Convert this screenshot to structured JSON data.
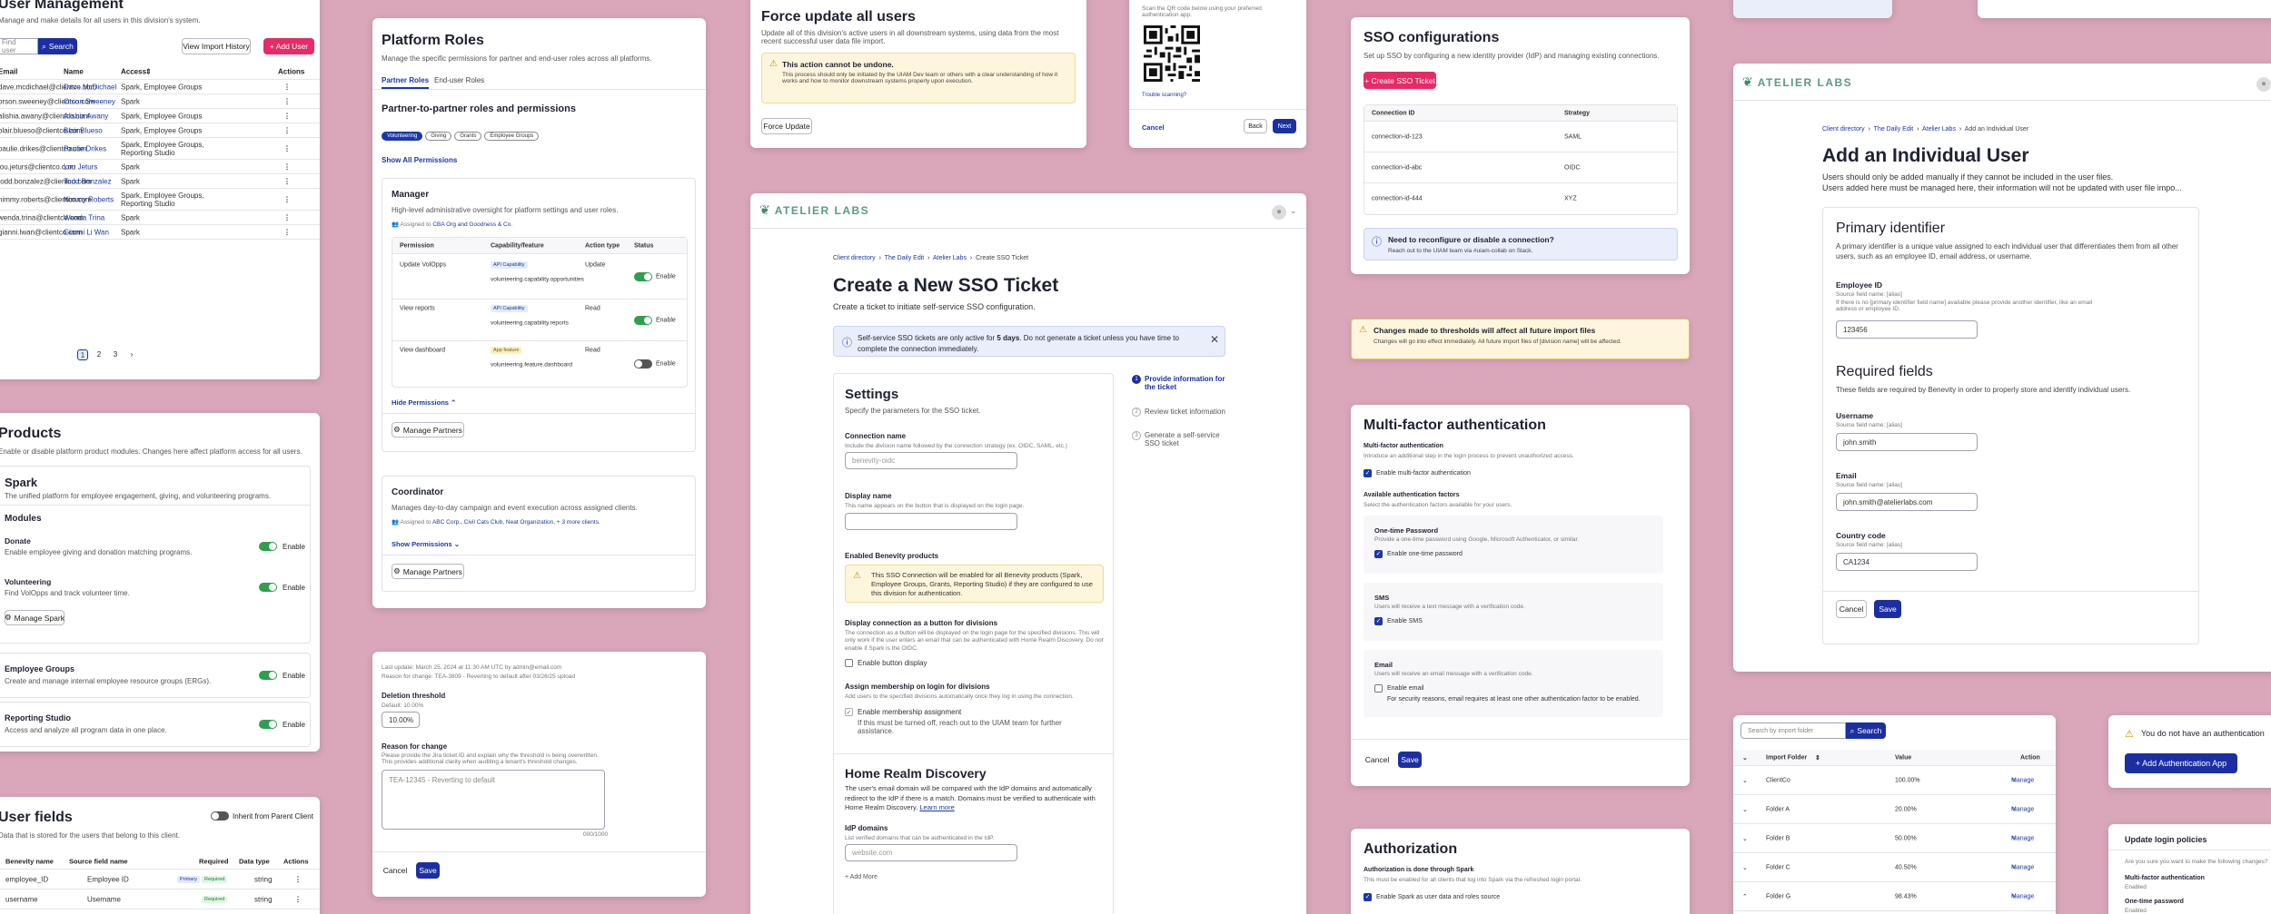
{
  "um": {
    "title": "User Management",
    "desc": "Manage and make details for all users in this division's system.",
    "search_ph": "Find user",
    "search_btn": "Search",
    "history_btn": "View Import History",
    "add_btn": "+ Add User",
    "cols": [
      "Email",
      "Name",
      "Access",
      "Actions"
    ],
    "rows": [
      [
        "dave.mcdichael@clientco.com",
        "Dave McDichael",
        "Spark, Employee Groups"
      ],
      [
        "orson.sweeney@clientco.com",
        "Orson Sweeney",
        "Spark"
      ],
      [
        "alishia.awany@clientco.com",
        "Alishia Awany",
        "Spark, Employee Groups"
      ],
      [
        "blair.blueso@clientco.com",
        "Blair Blueso",
        "Spark, Employee Groups"
      ],
      [
        "paulie.drikes@clientco.com",
        "Paulie Drikes",
        "Spark, Employee Groups, Reporting Studio"
      ],
      [
        "lou.jeturs@clientco.com",
        "Lou Jeturs",
        "Spark"
      ],
      [
        "todd.bonzalez@clientco.com",
        "Todd Bonzalez",
        "Spark"
      ],
      [
        "nimmy.roberts@clientco.com",
        "Nimmy Roberts",
        "Spark, Employee Groups, Reporting Studio"
      ],
      [
        "wenda.trina@clientco.com",
        "Wenda Trina",
        "Spark"
      ],
      [
        "gianni.lwan@clientco.com",
        "Gianni Li Wan",
        "Spark"
      ]
    ],
    "pages": [
      "1",
      "2",
      "3",
      "›"
    ]
  },
  "products": {
    "title": "Products",
    "desc": "Enable or disable platform product modules. Changes here affect platform access for all users.",
    "spark_title": "Spark",
    "spark_desc": "The unified platform for employee engagement, giving, and volunteering programs.",
    "modules_title": "Modules",
    "donate_title": "Donate",
    "donate_desc": "Enable employee giving and donation matching programs.",
    "vol_title": "Volunteering",
    "vol_desc": "Find VolOpps and track volunteer time.",
    "enable": "Enable",
    "manage_spark": "Manage Spark",
    "eg_title": "Employee Groups",
    "eg_desc": "Create and manage internal employee resource groups (ERGs).",
    "rs_title": "Reporting Studio",
    "rs_desc": "Access and analyze all program data in one place."
  },
  "uf": {
    "title": "User fields",
    "inherit": "Inherit from Parent Client",
    "desc": "Data that is stored for the users that belong to this client.",
    "cols": [
      "Benevity name",
      "Source field name",
      "Required",
      "Data type",
      "Actions"
    ],
    "rows": [
      [
        "employee_ID",
        "Employee ID",
        "Primary",
        "Required",
        "string"
      ],
      [
        "username",
        "Username",
        "",
        "Required",
        "string"
      ]
    ]
  },
  "pr": {
    "title": "Platform Roles",
    "desc": "Manage the specific permissions for partner and end-user roles across all platforms.",
    "tab1": "Partner Roles",
    "tab2": "End-user Roles",
    "sub": "Partner-to-partner roles and permissions",
    "tags": [
      "Volunteering",
      "Giving",
      "Grants",
      "Employee Groups"
    ],
    "show_all": "Show All Permissions",
    "mgr_title": "Manager",
    "mgr_desc": "High-level administrative oversight for platform settings and user roles.",
    "mgr_assigned_pre": "Assigned to ",
    "mgr_assigned": "CBA Org and Goodness & Co.",
    "cols": [
      "Permission",
      "Capability/feature",
      "Action type",
      "Status"
    ],
    "rows": [
      [
        "Update VolOpps",
        "API Capability",
        "volunteering.capability.opportunities",
        "Update"
      ],
      [
        "View reports",
        "API Capability",
        "volunteering.capability.reports",
        "Read"
      ],
      [
        "View dashboard",
        "App feature",
        "volunteering.feature.dashboard",
        "Read"
      ]
    ],
    "enable": "Enable",
    "hide": "Hide Permissions",
    "manage_partners": "Manage Partners",
    "coord_title": "Coordinator",
    "coord_desc": "Manages day-to-day campaign and event execution across assigned clients.",
    "coord_assigned": "ABC Corp., Civil Cats Club, Neat Organization, + 3 more clients.",
    "show": "Show Permissions"
  },
  "th": {
    "updated": "Last update: March 25, 2024 at 11:30 AM UTC by admin@email.com",
    "reason_prev": "Reason for change: TEA-3809 - Reverting to default after 03/26/25 upload",
    "deletion": "Deletion threshold",
    "default": "Default: 10.00%",
    "value": "10.00%",
    "reason": "Reason for change",
    "reason_help": "Please provide the Jira ticket ID and explain why the threshold is being overwritten. This provides additional clarity when auditing a tenant's threshold changes.",
    "reason_ph": "TEA-12345 - Reverting to default",
    "count": "000/1000",
    "cancel": "Cancel",
    "save": "Save"
  },
  "fu": {
    "title": "Force update all users",
    "desc": "Update all of this division's active users in all downstream systems, using data from the most recent successful user data file import.",
    "warn_title": "This action cannot be undone.",
    "warn_body": "This process should only be initiated by the UIAM Dev team or others with a clear understanding of how it works and how to monitor downstream systems properly upon execution.",
    "btn": "Force Update"
  },
  "ticket": {
    "logo": "ATELIER LABS",
    "crumbs": [
      "Client directory",
      "The Daily Edit",
      "Atelier Labs",
      "Create SSO Ticket"
    ],
    "title": "Create a New SSO Ticket",
    "subtitle": "Create a ticket to initiate self-service SSO configuration.",
    "info_pre": "Self-service SSO tickets are only active for ",
    "info_bold": "5 days",
    "info_post": ". Do not generate a ticket unless you have time to complete the connection immediately.",
    "settings": "Settings",
    "settings_desc": "Specify the parameters for the SSO ticket.",
    "conn_name": "Connection name",
    "conn_help": "Include the division name followed by the connection strategy (ex. OIDC, SAML, etc.)",
    "conn_ph": "benevity-oidc",
    "disp_name": "Display name",
    "disp_help": "This name appears on the button that is displayed on the login page.",
    "products": "Enabled Benevity products",
    "prod_warn": "This SSO Connection will be enabled for all Benevity products (Spark, Employee Groups, Grants, Reporting Studio) if they are configured to use this division for authentication.",
    "disp_btn": "Display connection as a button for divisions",
    "disp_btn_help": "The connection as a button will be displayed on the login page for the specified divisions. This will only work if the user enters an email that can be authenticated with Home Realm Discovery. Do not enable if Spark is the OIDC.",
    "enable_btn": "Enable button display",
    "assign": "Assign membership on login for divisions",
    "assign_help": "Add users to the specified divisions automatically once they log in using the connection.",
    "enable_assign": "Enable membership assignment",
    "assign_note": "If this must be turned off, reach out to the UIAM team for further assistance.",
    "hrd": "Home Realm Discovery",
    "hrd_desc": "The user's email domain will be compared with the IdP domains and automatically redirect to the IdP if there is a match. Domains must be verified to authenticate with Home Realm Discovery.",
    "learn": "Learn more",
    "idp": "IdP domains",
    "idp_help": "List verified domains that can be authenticated in the IdP.",
    "idp_ph": "website.com",
    "add_more": "+ Add More",
    "steps": [
      "Provide information for the ticket",
      "Review ticket information",
      "Generate a self-service SSO ticket"
    ]
  },
  "qr": {
    "scan": "Scan the QR code below using your preferred authentication app.",
    "trouble": "Trouble scanning?",
    "cancel": "Cancel",
    "back": "Back",
    "next": "Next"
  },
  "sso": {
    "title": "SSO configurations",
    "desc": "Set up SSO by configuring a new identity provider (IdP) and managing existing connections.",
    "btn": "+ Create SSO Ticket",
    "cols": [
      "Connection ID",
      "Strategy"
    ],
    "rows": [
      [
        "connection-id-123",
        "SAML"
      ],
      [
        "connection-id-abc",
        "OIDC"
      ],
      [
        "connection-id-444",
        "XYZ"
      ]
    ],
    "info_title": "Need to reconfigure or disable a connection?",
    "info_body": "Reach out to the UIAM team via #uiam-collab on Slack."
  },
  "thr": {
    "title": "Changes made to thresholds will affect all future import files",
    "body": "Changes will go into effect immediately. All future import files of [division name] will be affected."
  },
  "mfa": {
    "title": "Multi-factor authentication",
    "mfa_label": "Multi-factor authentication",
    "mfa_help": "Introduce an additional step in the login process to prevent unauthorized access.",
    "enable_mfa": "Enable multi-factor authentication",
    "factors": "Available authentication factors",
    "factors_help": "Select the authentication factors available for your users.",
    "otp": "One-time Password",
    "otp_help": "Provide a one-time password using Google, Microsoft Authenticator, or similar.",
    "enable_otp": "Enable one-time password",
    "sms": "SMS",
    "sms_help": "Users will receive a text message with a verification code.",
    "enable_sms": "Enable SMS",
    "email": "Email",
    "email_help": "Users will receive an email message with a verification code.",
    "enable_email": "Enable email",
    "email_note": "For security reasons, email requires at least one other authentication factor to be enabled.",
    "cancel": "Cancel",
    "save": "Save"
  },
  "auth": {
    "title": "Authorization",
    "label": "Authorization is done through Spark",
    "help": "This must be enabled for all clients that log into Spark via the refreshed login portal.",
    "enable": "Enable Spark as user data and roles source"
  },
  "aiu": {
    "logo": "ATELIER LABS",
    "crumbs": [
      "Client directory",
      "The Daily Edit",
      "Atelier Labs",
      "Add an Individual User"
    ],
    "title": "Add an Individual User",
    "desc1": "Users should only be added manually if they cannot be included in the user files.",
    "desc2": "Users added here must be managed here, their information will not be updated with user file impo...",
    "pi_title": "Primary identifier",
    "pi_desc": "A primary identifier is a unique value assigned to each individual user that differentiates them from all other users, such as an employee ID, email address, or username.",
    "emp_label": "Employee ID",
    "emp_src": "Source field name: [alias]",
    "emp_help": "If there is no [primary identifier field name] available please provide another identifier, like an email address or employee ID.",
    "emp_val": "123456",
    "rf_title": "Required fields",
    "rf_desc": "These fields are required by Benevity in order to properly store and identify individual users.",
    "user_label": "Username",
    "user_src": "Source field name: [alias]",
    "user_val": "john.smith",
    "email_label": "Email",
    "email_src": "Source field name: [alias]",
    "email_val": "john.smith@atelierlabs.com",
    "cc_label": "Country code",
    "cc_src": "Source field name: [alias]",
    "cc_val": "CA1234",
    "cancel": "Cancel",
    "save": "Save"
  },
  "imp": {
    "search_ph": "Search by import folder",
    "search_btn": "Search",
    "cols": [
      "Import Folder",
      "Value",
      "Action"
    ],
    "rows": [
      [
        "ClientCo",
        "100.00%"
      ],
      [
        "Folder A",
        "20.00%"
      ],
      [
        "Folder B",
        "50.00%"
      ],
      [
        "Folder C",
        "40.50%"
      ],
      [
        "Folder G",
        "98.43%"
      ]
    ],
    "manage": "Manage"
  },
  "noauth": {
    "msg": "You do not have an authentication",
    "btn": "+ Add Authentication App"
  },
  "ulp": {
    "title": "Update login policies",
    "q": "Are you sure you want to make the following changes?",
    "mfa": "Multi-factor authentication",
    "mfa_val": "Enabled",
    "otp": "One-time password",
    "otp_val": "Enabled"
  }
}
